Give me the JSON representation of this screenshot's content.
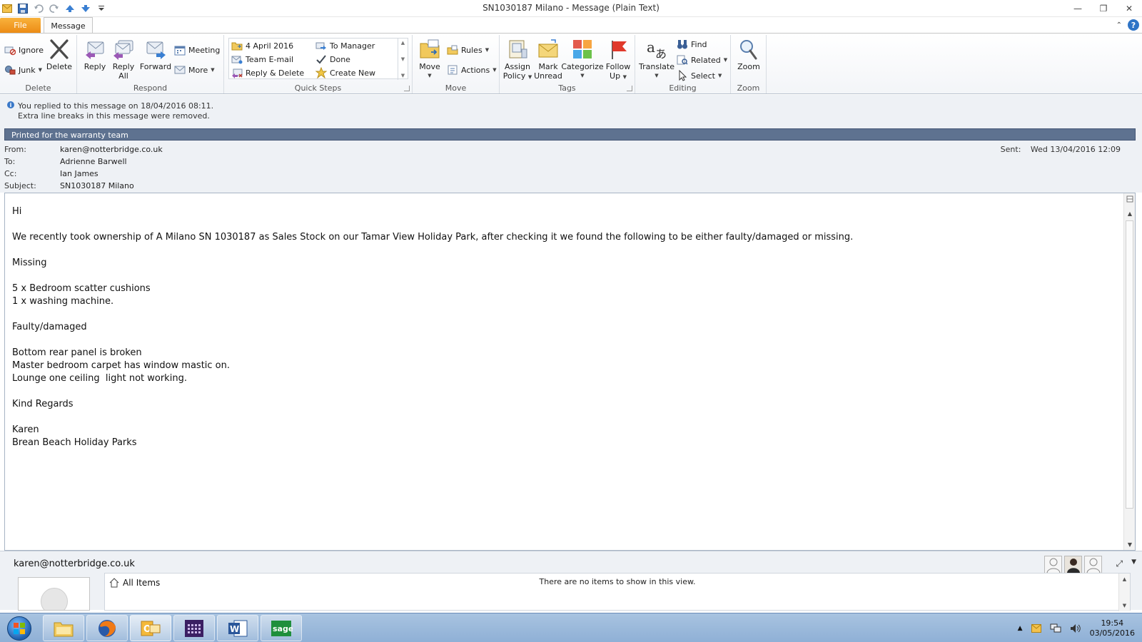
{
  "window": {
    "title": "SN1030187 Milano  -  Message (Plain Text)"
  },
  "ribbon": {
    "tabs": {
      "file": "File",
      "message": "Message"
    },
    "delete_group": {
      "label": "Delete",
      "ignore": "Ignore",
      "junk": "Junk",
      "delete": "Delete"
    },
    "respond_group": {
      "label": "Respond",
      "reply": "Reply",
      "reply_all_1": "Reply",
      "reply_all_2": "All",
      "forward": "Forward",
      "meeting": "Meeting",
      "more": "More"
    },
    "quick_steps_group": {
      "label": "Quick Steps",
      "items": [
        "4 April 2016",
        "To Manager",
        "Team E-mail",
        "Done",
        "Reply & Delete",
        "Create New"
      ]
    },
    "move_group": {
      "label": "Move",
      "move": "Move",
      "rules": "Rules",
      "actions": "Actions"
    },
    "tags_group": {
      "label": "Tags",
      "assign_1": "Assign",
      "assign_2": "Policy",
      "mark_1": "Mark",
      "mark_2": "Unread",
      "categorize": "Categorize",
      "follow_1": "Follow",
      "follow_2": "Up"
    },
    "editing_group": {
      "label": "Editing",
      "translate": "Translate",
      "find": "Find",
      "related": "Related",
      "select": "Select"
    },
    "zoom_group": {
      "label": "Zoom",
      "zoom": "Zoom"
    }
  },
  "info": {
    "line1": "You replied to this message on 18/04/2016 08:11.",
    "line2": "Extra line breaks in this message were removed."
  },
  "header": {
    "banner": "Printed for the warranty team",
    "from_label": "From:",
    "from": "karen@notterbridge.co.uk",
    "to_label": "To:",
    "to": "Adrienne Barwell",
    "cc_label": "Cc:",
    "cc": "Ian James",
    "subject_label": "Subject:",
    "subject": "SN1030187 Milano",
    "sent_label": "Sent:",
    "sent": "Wed 13/04/2016 12:09"
  },
  "body": {
    "text": "Hi\n\nWe recently took ownership of A Milano SN 1030187 as Sales Stock on our Tamar View Holiday Park, after checking it we found the following to be either faulty/damaged or missing.\n\nMissing\n\n5 x Bedroom scatter cushions\n1 x washing machine.\n\nFaulty/damaged\n\nBottom rear panel is broken\nMaster bedroom carpet has window mastic on.\nLounge one ceiling  light not working.\n\nKind Regards\n\nKaren\nBrean Beach Holiday Parks"
  },
  "people_pane": {
    "email": "karen@notterbridge.co.uk",
    "all_items": "All Items",
    "empty": "There are no items to show in this view."
  },
  "taskbar": {
    "time": "19:54",
    "date": "03/05/2016",
    "sage_label": "sage"
  },
  "colors": {
    "file_tab": "#ec8c15",
    "banner": "#5e7290",
    "taskbar": "#9ab8db"
  }
}
